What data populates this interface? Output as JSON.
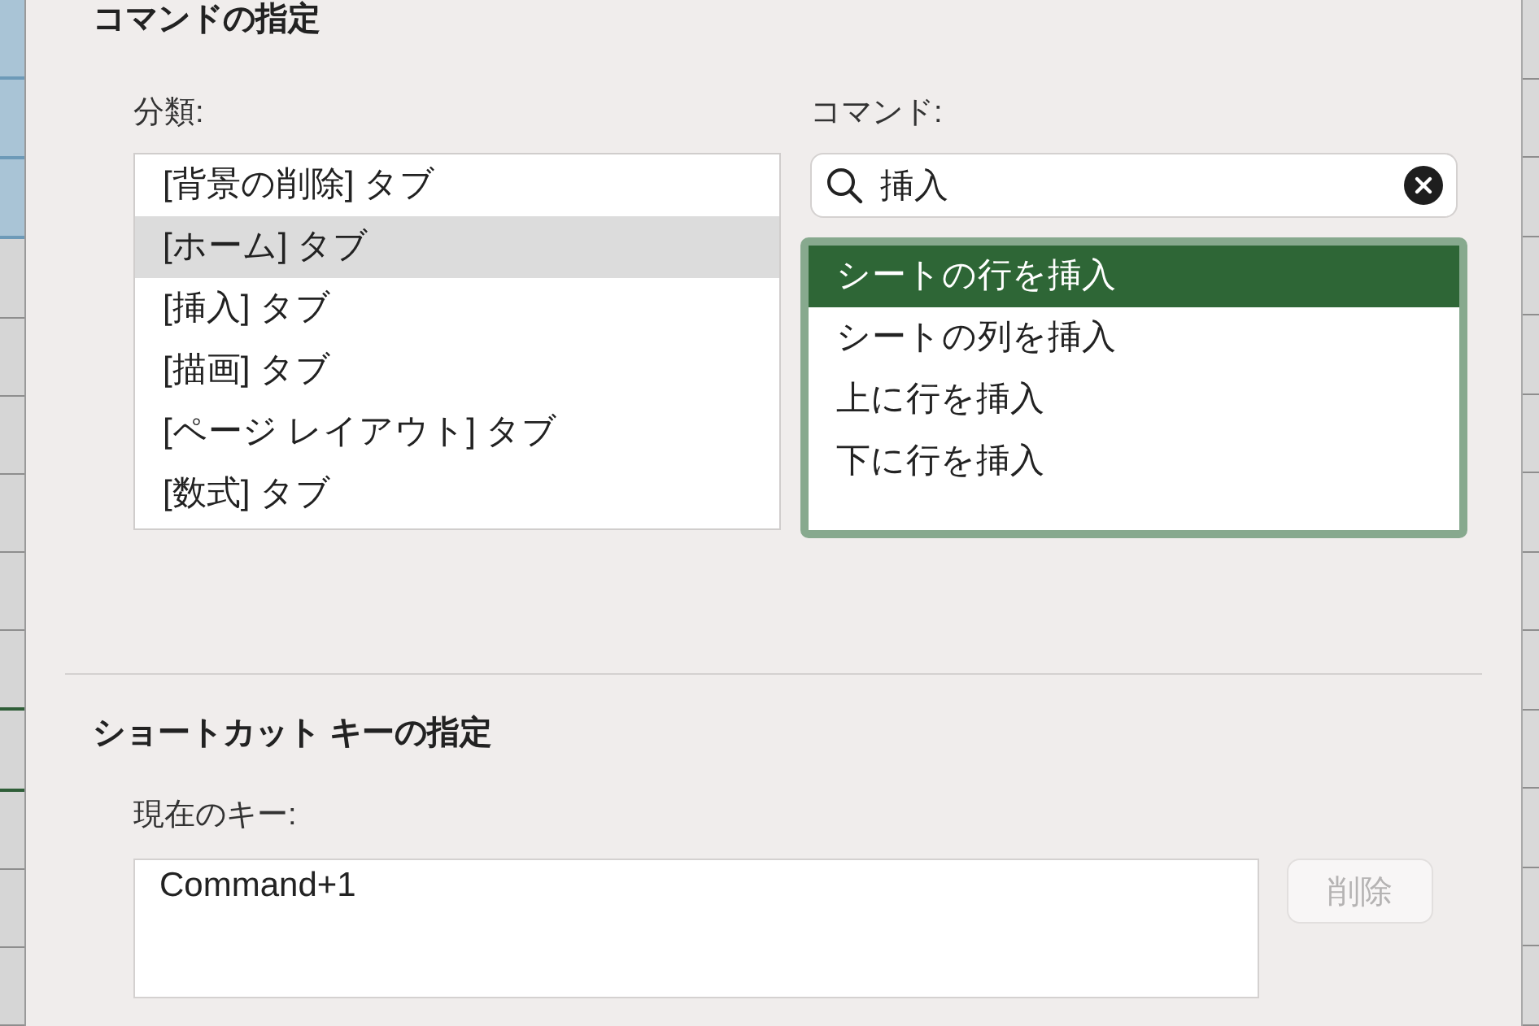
{
  "command_section": {
    "title": "コマンドの指定",
    "categories": {
      "label": "分類:",
      "items": [
        {
          "label": "[背景の削除] タブ",
          "selected": false
        },
        {
          "label": "[ホーム] タブ",
          "selected": true
        },
        {
          "label": "[挿入] タブ",
          "selected": false
        },
        {
          "label": "[描画] タブ",
          "selected": false
        },
        {
          "label": "[ページ レイアウト] タブ",
          "selected": false
        },
        {
          "label": "[数式] タブ",
          "selected": false
        }
      ]
    },
    "commands": {
      "label": "コマンド:",
      "search": {
        "value": "挿入"
      },
      "items": [
        {
          "label": "シートの行を挿入",
          "selected": true
        },
        {
          "label": "シートの列を挿入",
          "selected": false
        },
        {
          "label": "上に行を挿入",
          "selected": false
        },
        {
          "label": "下に行を挿入",
          "selected": false
        }
      ]
    }
  },
  "shortcut_section": {
    "title": "ショートカット キーの指定",
    "current_keys_label": "現在のキー:",
    "current_keys": [
      "Command+1"
    ],
    "remove_button": {
      "label": "削除",
      "disabled": true
    }
  }
}
